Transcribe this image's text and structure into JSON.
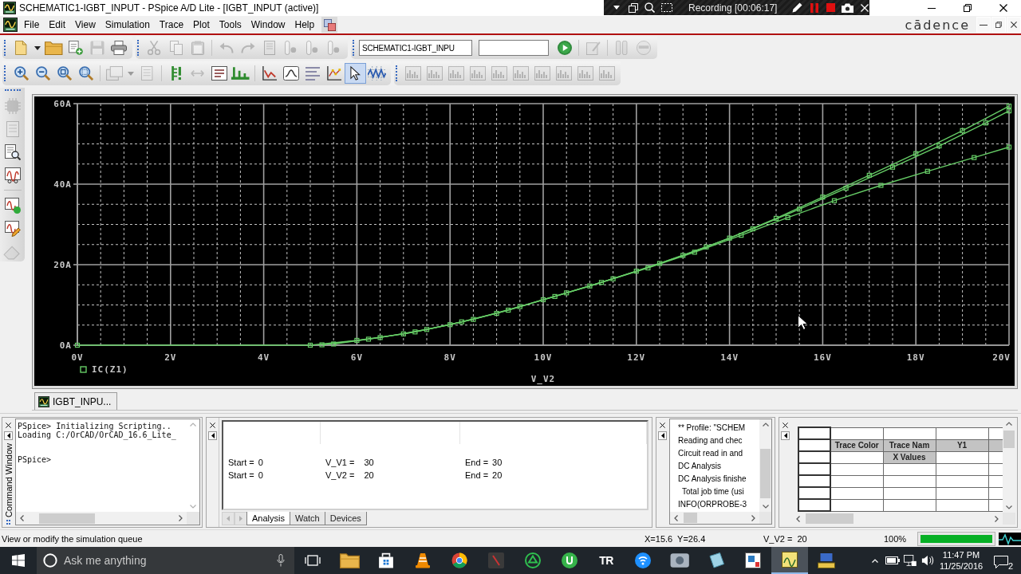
{
  "window": {
    "title": "SCHEMATIC1-IGBT_INPUT - PSpice A/D Lite - [IGBT_INPUT (active)]"
  },
  "recorder": {
    "status": "Recording [00:06:17]"
  },
  "menu_bar": {
    "items": [
      "File",
      "Edit",
      "View",
      "Simulation",
      "Trace",
      "Plot",
      "Tools",
      "Window",
      "Help"
    ],
    "logo": "cādence"
  },
  "toolbar_rows": [
    {
      "groups": [
        {
          "items": [
            {
              "kind": "button",
              "disabled": false
            },
            {
              "kind": "button",
              "disabled": false
            },
            {
              "kind": "button",
              "disabled": false
            },
            {
              "kind": "button",
              "disabled": false
            },
            {
              "kind": "button",
              "disabled": true
            },
            {
              "kind": "button",
              "disabled": false
            }
          ]
        },
        {
          "items": [
            {
              "kind": "button",
              "disabled": true
            },
            {
              "kind": "button",
              "disabled": true
            },
            {
              "kind": "button",
              "disabled": true
            },
            {
              "kind": "button",
              "disabled": true
            },
            {
              "kind": "button",
              "disabled": true
            },
            {
              "kind": "button",
              "disabled": true
            },
            {
              "kind": "button",
              "disabled": true
            },
            {
              "kind": "button",
              "disabled": true
            },
            {
              "kind": "button",
              "disabled": true
            }
          ]
        },
        {
          "items": [
            {
              "kind": "field",
              "value": "SCHEMATIC1-IGBT_INPU"
            },
            {
              "kind": "dropdown"
            },
            {
              "kind": "button",
              "disabled": false
            },
            {
              "kind": "button",
              "disabled": true
            },
            {
              "kind": "button",
              "disabled": true
            },
            {
              "kind": "button",
              "disabled": true
            }
          ]
        }
      ]
    },
    {
      "groups": [
        {
          "items": [
            {
              "kind": "button",
              "disabled": false
            },
            {
              "kind": "button",
              "disabled": false
            },
            {
              "kind": "button",
              "disabled": false
            },
            {
              "kind": "button",
              "disabled": false
            },
            {
              "kind": "button",
              "disabled": true
            },
            {
              "kind": "button",
              "disabled": true
            },
            {
              "kind": "button",
              "disabled": true
            },
            {
              "kind": "button",
              "disabled": false
            },
            {
              "kind": "button",
              "disabled": true
            },
            {
              "kind": "button",
              "disabled": false
            },
            {
              "kind": "button",
              "disabled": false
            },
            {
              "kind": "button",
              "disabled": false
            },
            {
              "kind": "button",
              "disabled": false
            },
            {
              "kind": "button",
              "disabled": false
            },
            {
              "kind": "button",
              "disabled": false
            },
            {
              "kind": "toggle",
              "on": true
            },
            {
              "kind": "button",
              "disabled": false
            }
          ]
        },
        {
          "items": [
            {
              "kind": "button",
              "disabled": true
            },
            {
              "kind": "button",
              "disabled": true
            },
            {
              "kind": "button",
              "disabled": true
            },
            {
              "kind": "button",
              "disabled": true
            },
            {
              "kind": "button",
              "disabled": true
            },
            {
              "kind": "button",
              "disabled": true
            },
            {
              "kind": "button",
              "disabled": true
            },
            {
              "kind": "button",
              "disabled": true
            },
            {
              "kind": "button",
              "disabled": true
            },
            {
              "kind": "button",
              "disabled": true
            }
          ]
        }
      ]
    }
  ],
  "side_toolbar": {
    "items": [
      {
        "disabled": true
      },
      {
        "disabled": true
      },
      {
        "disabled": false
      },
      {
        "disabled": false
      },
      {
        "disabled": false
      },
      {
        "disabled": false
      },
      {
        "disabled": true
      }
    ]
  },
  "plot": {
    "tab": "IGBT_INPU...",
    "chart_data": {
      "type": "line",
      "xlabel": "V_V2",
      "x": [
        0,
        5,
        6,
        7,
        8,
        9,
        10,
        11,
        12,
        13,
        14,
        15,
        16,
        17,
        18,
        19,
        20
      ],
      "xlim": [
        0,
        20
      ],
      "ylim": [
        0,
        60
      ],
      "xticks": [
        {
          "value": 0,
          "label": "0V"
        },
        {
          "value": 2,
          "label": "2V"
        },
        {
          "value": 4,
          "label": "4V"
        },
        {
          "value": 6,
          "label": "6V"
        },
        {
          "value": 8,
          "label": "8V"
        },
        {
          "value": 10,
          "label": "10V"
        },
        {
          "value": 12,
          "label": "12V"
        },
        {
          "value": 14,
          "label": "14V"
        },
        {
          "value": 16,
          "label": "16V"
        },
        {
          "value": 18,
          "label": "18V"
        },
        {
          "value": 20,
          "label": "20V"
        }
      ],
      "yticks": [
        {
          "value": 0,
          "label": "0A"
        },
        {
          "value": 20,
          "label": "20A"
        },
        {
          "value": 40,
          "label": "40A"
        },
        {
          "value": 60,
          "label": "60A"
        }
      ],
      "grid": true,
      "marker": "square",
      "legend": "bottom",
      "series": [
        {
          "name": "IC(Z1)",
          "color": "#66cc66",
          "values": [
            0,
            0,
            1.2,
            2.8,
            5.1,
            7.9,
            11.3,
            14.7,
            18.4,
            22.3,
            26.6,
            31.5,
            36.8,
            42.2,
            47.6,
            53.3,
            59.4
          ]
        },
        {
          "color": "#66cc66",
          "x": [
            5.5,
            6.5,
            7.5,
            8.5,
            9.5,
            10.5,
            11.5,
            12.5,
            13.5,
            14.5,
            15.5,
            16.5,
            17.5,
            18.5,
            19.5,
            20
          ],
          "values": [
            0.3,
            1.9,
            3.9,
            6.4,
            9.6,
            13.0,
            16.5,
            20.3,
            24.4,
            28.9,
            33.8,
            39.0,
            44.2,
            49.5,
            55.2,
            58.2
          ]
        },
        {
          "color": "#66cc66",
          "x": [
            5.25,
            6.25,
            7.25,
            8.25,
            9.25,
            10.25,
            11.25,
            12.25,
            13.25,
            14.25,
            15.25,
            16.25,
            17.25,
            18.25,
            19.25,
            20
          ],
          "values": [
            0.1,
            1.5,
            3.3,
            5.8,
            8.7,
            12.1,
            15.6,
            19.2,
            23.1,
            27.3,
            31.7,
            35.9,
            39.7,
            43.2,
            46.6,
            49.2
          ]
        }
      ]
    }
  },
  "command_window": {
    "title": "Command Window",
    "blocks": [
      [
        "PSpice> Initializing Scripting..",
        "Loading C:/OrCAD/OrCAD_16.6_Lite_"
      ],
      [
        "PSpice>"
      ]
    ]
  },
  "simulation_settings": {
    "rows": [
      [
        {
          "label": "Start =",
          "value": "0"
        },
        {
          "label": "V_V1 =",
          "value": "30"
        },
        {
          "label": "End =",
          "value": "30"
        }
      ],
      [
        {
          "label": "Start =",
          "value": "0"
        },
        {
          "label": "V_V2 =",
          "value": "20"
        },
        {
          "label": "End =",
          "value": "20"
        }
      ]
    ],
    "tabs": [
      {
        "label": "Analysis",
        "selected": true
      },
      {
        "label": "Watch",
        "selected": false
      },
      {
        "label": "Devices",
        "selected": false
      }
    ]
  },
  "output": {
    "lines": [
      {
        "text": "** Profile: \"SCHEM"
      },
      {
        "text": "Reading and chec"
      },
      {
        "text": "Circuit read in and"
      },
      {
        "text": "DC Analysis"
      },
      {
        "text": "DC Analysis finishe",
        "children": [
          {
            "text": "Total job time (usi"
          }
        ]
      },
      {
        "text": "INFO(ORPROBE-3"
      }
    ]
  },
  "probe_table": {
    "headers": [
      "Trace Color",
      "Trace Nam",
      "Y1"
    ],
    "x_values": "X Values"
  },
  "status_bar": {
    "message": "View or modify the simulation queue",
    "cursor": "X=15.6  Y=26.4",
    "sweep": "V_V2 =  20",
    "zoom": "100%",
    "progress": {
      "level": 1
    }
  },
  "taskbar": {
    "search": {
      "placeholder": "Ask me anything"
    },
    "apps": [
      {
        "active": false
      },
      {
        "active": false
      },
      {
        "active": false
      },
      {
        "active": false
      },
      {
        "active": false
      },
      {
        "active": false
      },
      {
        "active": false
      },
      {
        "active": false,
        "label": "TR"
      },
      {
        "active": false
      },
      {
        "active": false
      },
      {
        "active": false
      },
      {
        "active": false
      },
      {
        "active": true
      },
      {
        "active": false
      }
    ],
    "time": "11:47 PM",
    "date": "11/25/2016",
    "notifications": "2"
  }
}
